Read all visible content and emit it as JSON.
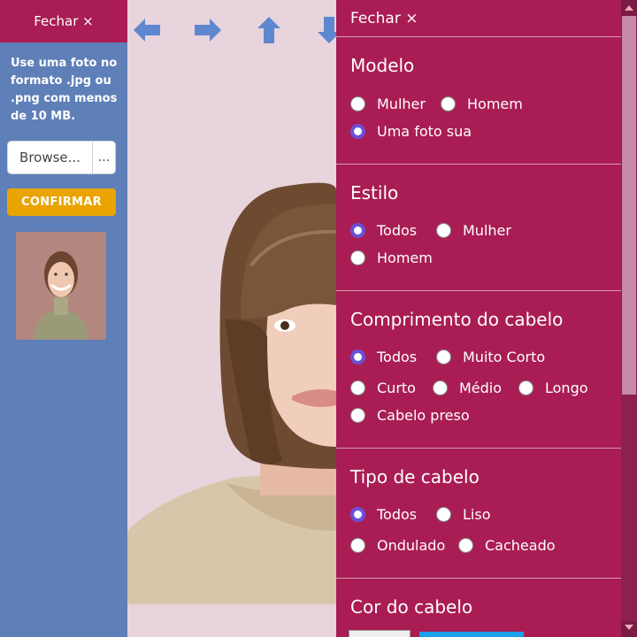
{
  "left": {
    "close_label": "Fechar ×",
    "info": "Use uma foto no formato .jpg ou .png com menos de 10 MB.",
    "browse_label": "Browse...",
    "browse_dots": "...",
    "confirm_label": "CONFIRMAR"
  },
  "toolbar": {
    "icons": [
      "arrow-left-icon",
      "arrow-right-icon",
      "arrow-up-icon",
      "arrow-down-icon"
    ],
    "color": "#5f87cf"
  },
  "options": {
    "close_label": "Fechar ×",
    "sections": [
      {
        "title": "Modelo",
        "options": [
          {
            "label": "Mulher",
            "checked": false
          },
          {
            "label": "Homem",
            "checked": false
          },
          {
            "label": "Uma foto sua",
            "checked": true
          }
        ]
      },
      {
        "title": "Estilo",
        "options": [
          {
            "label": "Todos",
            "checked": true
          },
          {
            "label": "Mulher",
            "checked": false
          },
          {
            "label": "Homem",
            "checked": false
          }
        ]
      },
      {
        "title": "Comprimento do cabelo",
        "options": [
          {
            "label": "Todos",
            "checked": true
          },
          {
            "label": "Muito Corto",
            "checked": false
          },
          {
            "label": "Curto",
            "checked": false
          },
          {
            "label": "Médio",
            "checked": false
          },
          {
            "label": "Longo",
            "checked": false
          },
          {
            "label": "Cabelo preso",
            "checked": false
          }
        ]
      },
      {
        "title": "Tipo de cabelo",
        "options": [
          {
            "label": "Todos",
            "checked": true
          },
          {
            "label": "Liso",
            "checked": false
          },
          {
            "label": "Ondulado",
            "checked": false
          },
          {
            "label": "Cacheado",
            "checked": false
          }
        ]
      },
      {
        "title": "Cor do cabelo",
        "options": []
      }
    ]
  },
  "colors": {
    "panel_magenta": "#a91d54",
    "left_blue": "#5f7fb8",
    "confirm_yellow": "#e9a400",
    "radio_checked": "#6a50d8"
  }
}
